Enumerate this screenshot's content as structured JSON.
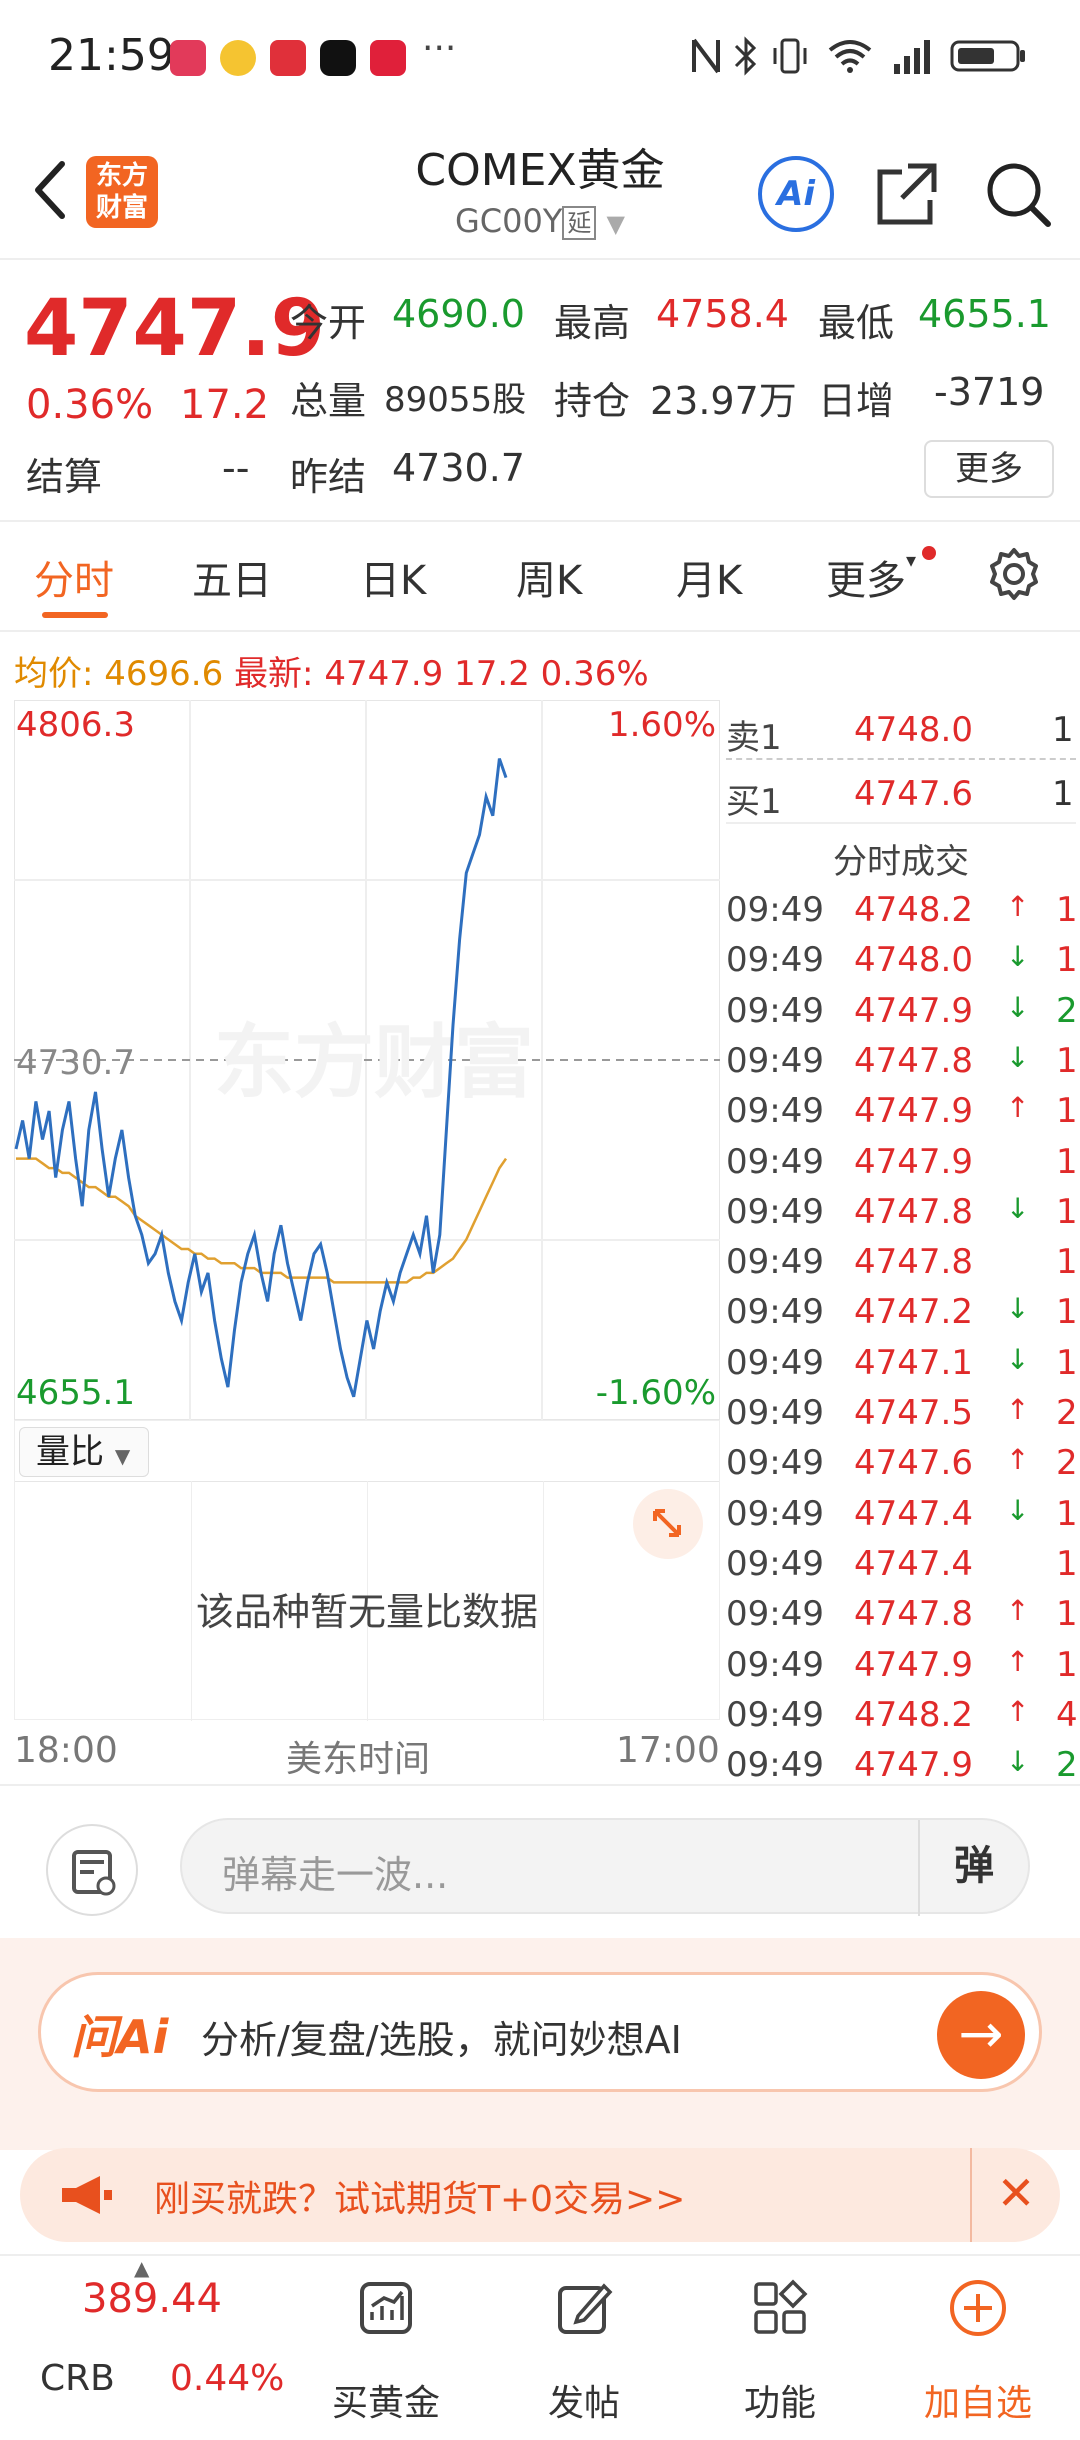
{
  "status": {
    "time": "21:59",
    "more": "···"
  },
  "header": {
    "title": "COMEX黄金",
    "code": "GC00Y",
    "tag": "延",
    "logo_line1": "东方",
    "logo_line2": "财富",
    "ai_label": "Ai"
  },
  "quote": {
    "price": "4747.9",
    "change_pct": "0.36%",
    "change_val": "17.2",
    "open_label": "今开",
    "open": "4690.0",
    "high_label": "最高",
    "high": "4758.4",
    "low_label": "最低",
    "low": "4655.1",
    "volume_label": "总量",
    "volume": "89055股",
    "oi_label": "持仓",
    "oi": "23.97万",
    "daily_inc_label": "日增",
    "daily_inc": "-3719",
    "settle_label": "结算",
    "settle": "--",
    "prev_settle_label": "昨结",
    "prev_settle": "4730.7",
    "more_btn": "更多"
  },
  "tabs": [
    "分时",
    "五日",
    "日K",
    "周K",
    "月K",
    "更多"
  ],
  "infoline": {
    "avg_label": "均价:",
    "avg": "4696.6",
    "latest_label": "最新:",
    "latest": "4747.9",
    "chg": "17.2",
    "pct": "0.36%"
  },
  "chart": {
    "y_top": "4806.3",
    "y_mid": "4730.7",
    "y_bottom": "4655.1",
    "pct_top": "1.60%",
    "pct_bottom": "-1.60%",
    "x_start": "18:00",
    "x_mid": "美东时间",
    "x_end": "17:00",
    "watermark": "东方财富",
    "volume_selector": "量比",
    "volume_empty": "该品种暂无量比数据"
  },
  "chart_data": {
    "type": "line",
    "ylim": [
      4655.1,
      4806.3
    ],
    "series": [
      {
        "values": [
          4712,
          4718,
          4710,
          4722,
          4714,
          4720,
          4706,
          4716,
          4722,
          4710,
          4700,
          4716,
          4724,
          4712,
          4702,
          4710,
          4716,
          4706,
          4698,
          4694,
          4688,
          4690,
          4694,
          4686,
          4680,
          4676,
          4684,
          4690,
          4682,
          4686,
          4676,
          4668,
          4662,
          4674,
          4684,
          4690,
          4694,
          4686,
          4680,
          4690,
          4696,
          4688,
          4682,
          4676,
          4684,
          4690,
          4692,
          4686,
          4678,
          4670,
          4664,
          4660,
          4668,
          4676,
          4670,
          4678,
          4684,
          4680,
          4686,
          4690,
          4694,
          4690,
          4698,
          4686,
          4694,
          4716,
          4738,
          4756,
          4770,
          4774,
          4778,
          4786,
          4782,
          4794,
          4790
        ]
      },
      {
        "values": [
          4710,
          4710,
          4710,
          4710,
          4709,
          4708,
          4708,
          4707,
          4707,
          4706,
          4705,
          4704,
          4704,
          4703,
          4702,
          4702,
          4701,
          4700,
          4698,
          4697,
          4696,
          4695,
          4694,
          4693,
          4692,
          4691,
          4691,
          4690,
          4690,
          4689,
          4689,
          4688,
          4688,
          4688,
          4687,
          4687,
          4687,
          4686,
          4686,
          4686,
          4686,
          4685,
          4685,
          4685,
          4685,
          4685,
          4685,
          4685,
          4684,
          4684,
          4684,
          4684,
          4684,
          4684,
          4684,
          4684,
          4684,
          4684,
          4684,
          4684,
          4685,
          4685,
          4686,
          4686,
          4687,
          4688,
          4689,
          4691,
          4693,
          4696,
          4699,
          4702,
          4705,
          4708,
          4710
        ]
      }
    ]
  },
  "orderbook": {
    "sell1_label": "卖1",
    "sell1_price": "4748.0",
    "sell1_qty": "1",
    "buy1_label": "买1",
    "buy1_price": "4747.6",
    "buy1_qty": "1",
    "trades_title": "分时成交",
    "trades": [
      {
        "t": "09:49",
        "p": "4748.2",
        "d": "↑",
        "q": "1"
      },
      {
        "t": "09:49",
        "p": "4748.0",
        "d": "↓",
        "q": "1"
      },
      {
        "t": "09:49",
        "p": "4747.9",
        "d": "↓",
        "q": "2"
      },
      {
        "t": "09:49",
        "p": "4747.8",
        "d": "↓",
        "q": "1"
      },
      {
        "t": "09:49",
        "p": "4747.9",
        "d": "↑",
        "q": "1"
      },
      {
        "t": "09:49",
        "p": "4747.9",
        "d": "",
        "q": "1"
      },
      {
        "t": "09:49",
        "p": "4747.8",
        "d": "↓",
        "q": "1"
      },
      {
        "t": "09:49",
        "p": "4747.8",
        "d": "",
        "q": "1"
      },
      {
        "t": "09:49",
        "p": "4747.2",
        "d": "↓",
        "q": "1"
      },
      {
        "t": "09:49",
        "p": "4747.1",
        "d": "↓",
        "q": "1"
      },
      {
        "t": "09:49",
        "p": "4747.5",
        "d": "↑",
        "q": "2"
      },
      {
        "t": "09:49",
        "p": "4747.6",
        "d": "↑",
        "q": "2"
      },
      {
        "t": "09:49",
        "p": "4747.4",
        "d": "↓",
        "q": "1"
      },
      {
        "t": "09:49",
        "p": "4747.4",
        "d": "",
        "q": "1"
      },
      {
        "t": "09:49",
        "p": "4747.8",
        "d": "↑",
        "q": "1"
      },
      {
        "t": "09:49",
        "p": "4747.9",
        "d": "↑",
        "q": "1"
      },
      {
        "t": "09:49",
        "p": "4748.2",
        "d": "↑",
        "q": "4"
      },
      {
        "t": "09:49",
        "p": "4747.9",
        "d": "↓",
        "q": "2"
      }
    ]
  },
  "comment": {
    "placeholder": "弹幕走一波...",
    "danmu_btn": "弹"
  },
  "ai_banner": {
    "logo": "问Ai",
    "text": "分析/复盘/选股，就问妙想AI",
    "go": "→"
  },
  "promo": {
    "text": "刚买就跌？试试期货T+0交易>>",
    "close": "✕"
  },
  "bottomnav": {
    "crb_value": "389.44",
    "crb_label": "CRB",
    "crb_pct": "0.44%",
    "items": [
      "买黄金",
      "发帖",
      "功能",
      "加自选"
    ]
  },
  "colors": {
    "accent": "#f26522",
    "up": "#e02a2a",
    "down": "#1a9a2e",
    "line": "#2e6fbf",
    "avg_line": "#e0a030"
  }
}
